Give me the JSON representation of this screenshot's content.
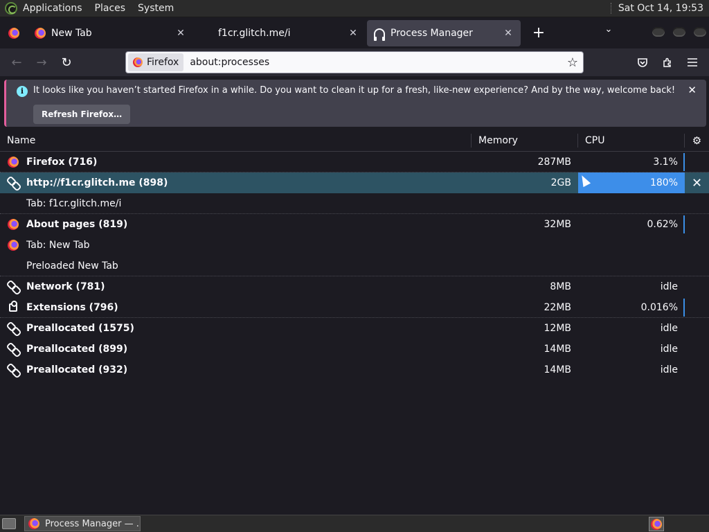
{
  "top_panel": {
    "menus": [
      "Applications",
      "Places",
      "System"
    ],
    "clock": "Sat Oct 14, 19:53"
  },
  "tabs": [
    {
      "title": "New Tab",
      "close": "✕"
    },
    {
      "title": "f1cr.glitch.me/i",
      "close": "✕"
    },
    {
      "title": "Process Manager",
      "close": "✕"
    }
  ],
  "tabbar": {
    "new_tab": "+",
    "list_all": "⌄"
  },
  "navbar": {
    "back": "←",
    "forward": "→",
    "reload": "↻",
    "identity_label": "Firefox",
    "url": "about:processes",
    "star": "☆"
  },
  "notification": {
    "message": "It looks like you haven’t started Firefox in a while. Do you want to clean it up for a fresh, like-new experience? And by the way, welcome back!",
    "button": "Refresh Firefox…",
    "close": "✕",
    "info": "i"
  },
  "table": {
    "headers": {
      "name": "Name",
      "memory": "Memory",
      "cpu": "CPU",
      "settings": "⚙"
    },
    "rows": [
      {
        "icon": "firefox",
        "name": "Firefox (716)",
        "bold": true,
        "memory": "287MB",
        "cpu": "3.1%",
        "bar": true
      },
      {
        "icon": "link",
        "name": "http://f1cr.glitch.me (898)",
        "bold": true,
        "memory": "2GB",
        "cpu": "180%",
        "selected": true,
        "action": "✕"
      },
      {
        "icon": "none",
        "name": "Tab: f1cr.glitch.me/i",
        "bold": false,
        "memory": "",
        "cpu": ""
      },
      {
        "icon": "firefox",
        "name": "About pages (819)",
        "bold": true,
        "memory": "32MB",
        "cpu": "0.62%",
        "bar": true
      },
      {
        "icon": "firefox",
        "name": "Tab: New Tab",
        "bold": false,
        "memory": "",
        "cpu": ""
      },
      {
        "icon": "none",
        "name": "Preloaded New Tab",
        "bold": false,
        "memory": "",
        "cpu": ""
      },
      {
        "icon": "link",
        "name": "Network (781)",
        "bold": true,
        "memory": "8MB",
        "cpu": "idle"
      },
      {
        "icon": "puzzle",
        "name": "Extensions (796)",
        "bold": true,
        "memory": "22MB",
        "cpu": "0.016%",
        "bar": true
      },
      {
        "icon": "link",
        "name": "Preallocated (1575)",
        "bold": true,
        "memory": "12MB",
        "cpu": "idle"
      },
      {
        "icon": "link",
        "name": "Preallocated (899)",
        "bold": true,
        "memory": "14MB",
        "cpu": "idle"
      },
      {
        "icon": "link",
        "name": "Preallocated (932)",
        "bold": true,
        "memory": "14MB",
        "cpu": "idle"
      }
    ]
  },
  "taskbar": {
    "task_title": "Process Manager — ..."
  },
  "colors": {
    "accent": "#3d8ee9",
    "selected_row": "#2d5363",
    "background": "#1c1b22"
  }
}
